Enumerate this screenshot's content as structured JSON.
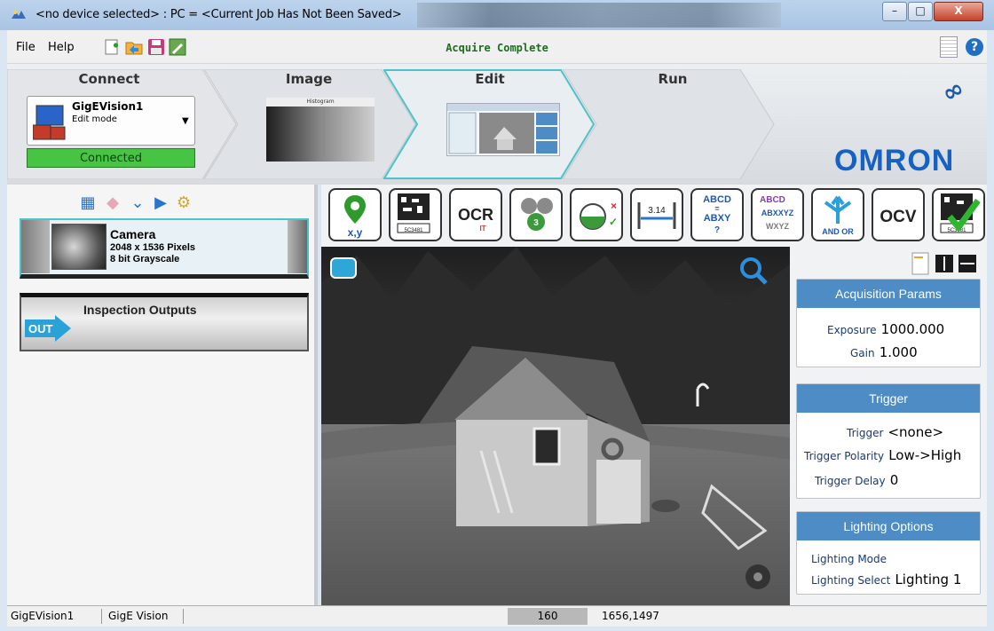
{
  "window": {
    "title": "<no device selected> : PC = <Current Job Has Not Been Saved>",
    "controls": {
      "minimize": "–",
      "maximize": "□",
      "close": "X"
    }
  },
  "menubar": {
    "items": [
      "File",
      "Help"
    ],
    "status": "Acquire Complete",
    "toolbar_icons": [
      "new-job-icon",
      "open-job-icon",
      "save-job-icon",
      "edit-job-icon"
    ]
  },
  "workflow": {
    "steps": [
      "Connect",
      "Image",
      "Edit",
      "Run"
    ],
    "active_step": "Edit",
    "device": {
      "name": "GigEVision1",
      "mode": "Edit mode"
    },
    "connection_status": "Connected",
    "histogram_title": "Histogram",
    "brand": "OMRON",
    "colors": {
      "connected": "#47c444",
      "brand": "#1562c4",
      "active_step_border": "#4cc3c8"
    }
  },
  "left_panel": {
    "toolbar_icons": [
      "layers-icon",
      "eraser-icon",
      "expand-down-icon",
      "play-icon",
      "settings-gear-icon"
    ],
    "camera": {
      "name": "Camera",
      "resolution": "2048 x 1536 Pixels",
      "bit_depth": "8 bit Grayscale"
    },
    "outputs": {
      "label": "Inspection Outputs",
      "badge": "OUT"
    }
  },
  "tools": [
    {
      "name": "locate-xy",
      "label": "x,y"
    },
    {
      "name": "barcode",
      "label": "5C3481"
    },
    {
      "name": "ocr",
      "label": "OCR",
      "sub": "IT"
    },
    {
      "name": "count-blobs",
      "label": ""
    },
    {
      "name": "presence-check",
      "label": ""
    },
    {
      "name": "measure-distance",
      "label": "3.14"
    },
    {
      "name": "string-compare",
      "label_top": "ABCD",
      "label_mid": "=",
      "label_bot": "ABXY",
      "label_q": "?"
    },
    {
      "name": "string-match",
      "label_top": "ABCD",
      "label_mid": "ABXXYZ",
      "label_bot": "WXYZ"
    },
    {
      "name": "logic",
      "label": "AND OR"
    },
    {
      "name": "ocv",
      "label": "OCV"
    },
    {
      "name": "barcode-verify",
      "label": "5C3481"
    }
  ],
  "params": {
    "acquisition": {
      "title": "Acquisition Params",
      "exposure_label": "Exposure",
      "exposure": "1000.000",
      "gain_label": "Gain",
      "gain": "1.000"
    },
    "trigger": {
      "title": "Trigger",
      "trigger_label": "Trigger",
      "trigger": "<none>",
      "polarity_label": "Trigger Polarity",
      "polarity": "Low->High",
      "delay_label": "Trigger Delay",
      "delay": "0"
    },
    "lighting": {
      "title": "Lighting Options",
      "mode_label": "Lighting Mode",
      "select_label": "Lighting Select",
      "select": "Lighting 1"
    }
  },
  "statusbar": {
    "device": "GigEVision1",
    "interface": "GigE Vision",
    "pixel_value": "160",
    "coordinates": "1656,1497"
  }
}
